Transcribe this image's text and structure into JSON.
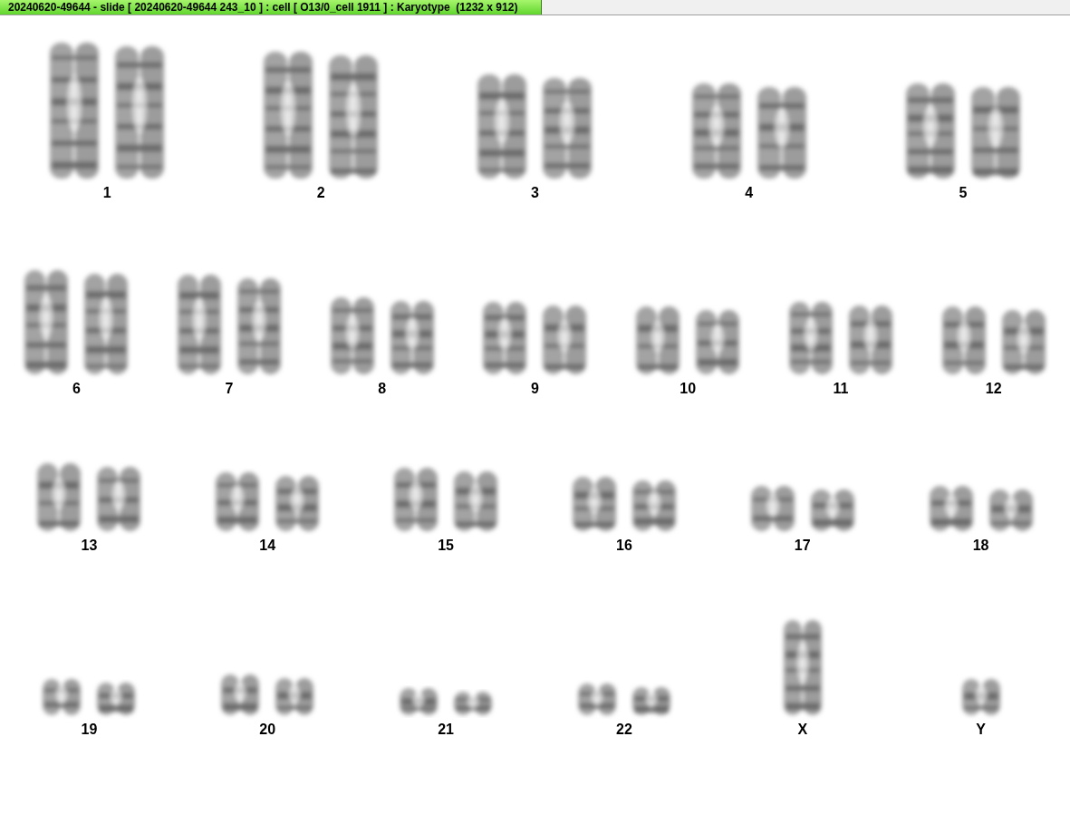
{
  "window": {
    "title": "20240620-49644 - slide [ 20240620-49644 243_10 ] : cell [ O13/0_cell 1911 ] : Karyotype  (1232 x 912)"
  },
  "karyotype": {
    "rows": [
      {
        "items": [
          {
            "label": "1",
            "kind": "pair"
          },
          {
            "label": "2",
            "kind": "pair"
          },
          {
            "label": "3",
            "kind": "pair"
          },
          {
            "label": "4",
            "kind": "pair"
          },
          {
            "label": "5",
            "kind": "pair"
          }
        ]
      },
      {
        "items": [
          {
            "label": "6",
            "kind": "pair"
          },
          {
            "label": "7",
            "kind": "pair"
          },
          {
            "label": "8",
            "kind": "pair"
          },
          {
            "label": "9",
            "kind": "pair"
          },
          {
            "label": "10",
            "kind": "pair"
          },
          {
            "label": "11",
            "kind": "pair"
          },
          {
            "label": "12",
            "kind": "pair"
          }
        ]
      },
      {
        "items": [
          {
            "label": "13",
            "kind": "pair"
          },
          {
            "label": "14",
            "kind": "pair"
          },
          {
            "label": "15",
            "kind": "pair"
          },
          {
            "label": "16",
            "kind": "pair"
          },
          {
            "label": "17",
            "kind": "pair"
          },
          {
            "label": "18",
            "kind": "pair"
          }
        ]
      },
      {
        "items": [
          {
            "label": "19",
            "kind": "pair"
          },
          {
            "label": "20",
            "kind": "pair"
          },
          {
            "label": "21",
            "kind": "pair"
          },
          {
            "label": "22",
            "kind": "pair"
          },
          {
            "label": "X",
            "kind": "single"
          },
          {
            "label": "Y",
            "kind": "single"
          }
        ]
      }
    ]
  }
}
